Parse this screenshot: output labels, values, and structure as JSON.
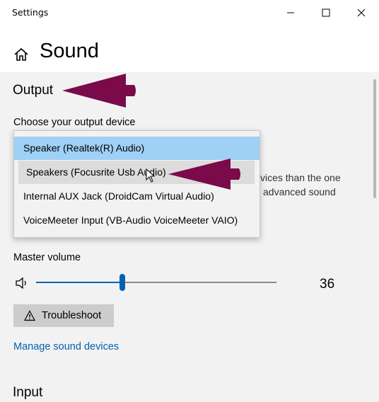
{
  "window": {
    "title": "Settings",
    "minimize_icon": "minimize-icon",
    "maximize_icon": "maximize-icon",
    "close_icon": "close-icon"
  },
  "header": {
    "home_icon": "home-icon",
    "title": "Sound"
  },
  "output": {
    "section_title": "Output",
    "device_label": "Choose your output device",
    "devices": [
      "Speaker (Realtek(R) Audio)",
      "Speakers (Focusrite Usb Audio)",
      "Internal AUX Jack (DroidCam Virtual Audio)",
      "VoiceMeeter Input (VB-Audio VoiceMeeter VAIO)"
    ],
    "selected_index": 0,
    "hovered_index": 1,
    "obscured_text_line1": "vices than the one",
    "obscured_text_line2": "advanced sound",
    "master_volume_label": "Master volume",
    "volume_icon": "speaker-volume-icon",
    "volume_value": "36",
    "volume_fraction": 0.36,
    "troubleshoot_icon": "warning-icon",
    "troubleshoot_label": "Troubleshoot",
    "manage_link": "Manage sound devices"
  },
  "input": {
    "section_title": "Input"
  },
  "colors": {
    "accent": "#0063b1",
    "selected_item": "#9fd0f5",
    "annotation_arrow": "#7a0a4a",
    "content_bg": "#f2f2f2"
  }
}
